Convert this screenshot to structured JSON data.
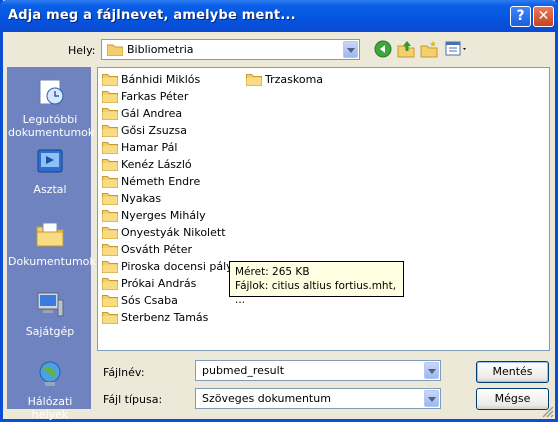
{
  "dialog": {
    "title": "Adja meg a fájlnevet, amelybe ment..."
  },
  "location": {
    "label": "Hely:",
    "value": "Bibliometria",
    "icons": [
      "folder-icon",
      "back-icon",
      "up-folder-icon",
      "new-folder-icon",
      "view-menu-icon"
    ]
  },
  "places": [
    {
      "label": "Legutóbbi dokumentumok",
      "icon": "recent-documents-icon"
    },
    {
      "label": "Asztal",
      "icon": "desktop-icon"
    },
    {
      "label": "Dokumentumok",
      "icon": "my-documents-icon"
    },
    {
      "label": "Sajátgép",
      "icon": "my-computer-icon"
    },
    {
      "label": "Hálózati helyek",
      "icon": "network-places-icon"
    }
  ],
  "files": {
    "column1": [
      "Bánhidi Miklós",
      "Farkas Péter",
      "Gál Andrea",
      "Gősi Zsuzsa",
      "Hamar Pál",
      "Kenéz László",
      "Németh Endre",
      "Nyakas",
      "Nyerges Mihály",
      "Onyestyák Nikolett",
      "Osváth Péter",
      "Piroska docensi pályázat",
      "Prókai András",
      "Sós Csaba",
      "Sterbenz Tamás"
    ],
    "column2": [
      "Trzaskoma"
    ]
  },
  "tooltip": {
    "size": "Méret: 265 KB",
    "files": "Fájlok: citius altius fortius.mht, ..."
  },
  "filename": {
    "label": "Fájlnév:",
    "value": "pubmed_result"
  },
  "filetype": {
    "label": "Fájl típusa:",
    "value": "Szöveges dokumentum"
  },
  "buttons": {
    "save": "Mentés",
    "cancel": "Mégse"
  },
  "colors": {
    "titlebar": "#0554e0",
    "places_bar": "#6f83c0",
    "folder": "#f3d06b",
    "dialog_bg": "#ece9d8"
  }
}
